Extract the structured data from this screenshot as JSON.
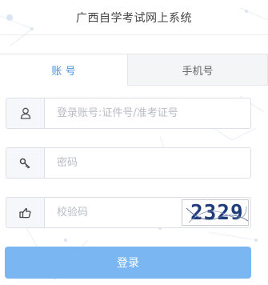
{
  "header": {
    "title": "广西自学考试网上系统"
  },
  "tabs": [
    {
      "label": "账 号",
      "active": true
    },
    {
      "label": "手机号",
      "active": false
    }
  ],
  "form": {
    "account": {
      "placeholder": "登录账号:证件号/准考证号",
      "value": "",
      "icon": "user-icon"
    },
    "password": {
      "placeholder": "密码",
      "value": "",
      "icon": "key-icon"
    },
    "captcha": {
      "placeholder": "校验码",
      "value": "",
      "icon": "hand-pointer-icon",
      "image_text": "2329"
    }
  },
  "submit": {
    "label": "登录"
  },
  "colors": {
    "accent": "#4a90e2",
    "button": "#79b6f2",
    "border": "#dcdfe6"
  }
}
